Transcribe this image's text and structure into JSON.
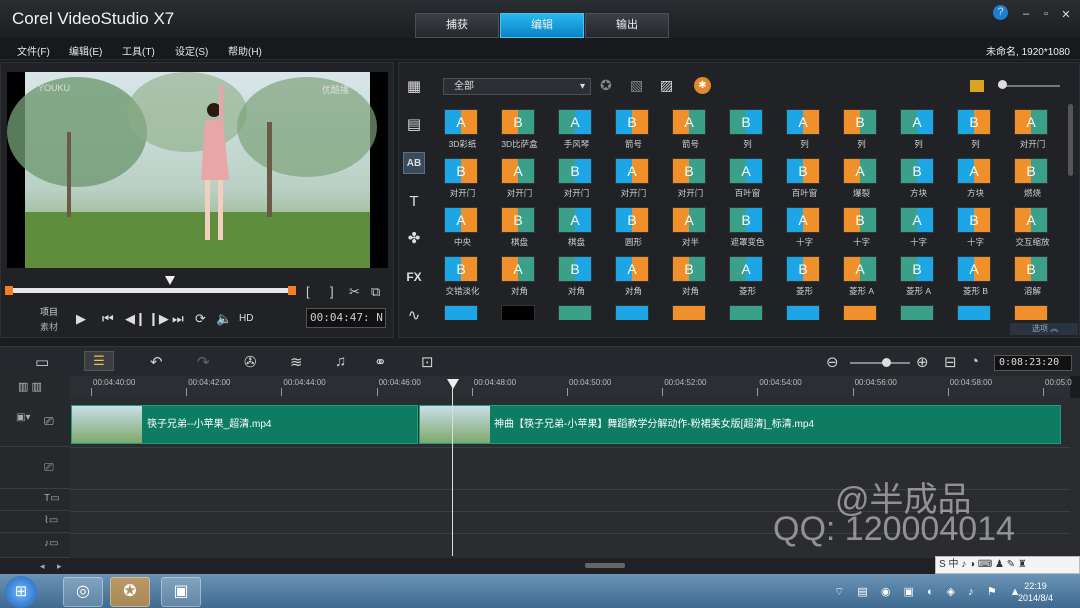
{
  "app_title": "Corel VideoStudio X7",
  "tabs": [
    "捕获",
    "编辑",
    "输出"
  ],
  "window_controls": [
    "?",
    "–",
    "▫",
    "✕"
  ],
  "menu": [
    "文件(F)",
    "编辑(E)",
    "工具(T)",
    "设定(S)",
    "帮助(H)"
  ],
  "doc_info": "未命名, 1920*1080",
  "preview": {
    "watermark_left": "YOUKU",
    "watermark_right": "优酷播",
    "mode_project": "项目",
    "mode_clip": "素材",
    "hd_label": "HD",
    "timecode": "00:04:47: N",
    "playhead_fraction": 0.58
  },
  "library": {
    "dropdown_value": "全部",
    "options_label": "选项",
    "transitions": [
      "3D彩纸",
      "3D比萨盒",
      "手风琴",
      "箭号",
      "箭号",
      "列",
      "列",
      "列",
      "列",
      "列",
      "对开门",
      "对开门",
      "对开门",
      "对开门",
      "对开门",
      "对开门",
      "百叶窗",
      "百叶窗",
      "爆裂",
      "方块",
      "方块",
      "燃烧",
      "中央",
      "棋盘",
      "棋盘",
      "圆形",
      "对半",
      "遮罩变色",
      "十字",
      "十字",
      "十字",
      "十字",
      "交互缩放",
      "交错淡化",
      "对角",
      "对角",
      "对角",
      "对角",
      "菱形",
      "菱形",
      "菱形 A",
      "菱形 A",
      "菱形 B",
      "溶解"
    ]
  },
  "timeline": {
    "current_time": "0:08:23:20",
    "ruler": [
      "00:04:40:00",
      "00:04:42:00",
      "00:04:44:00",
      "00:04:46:00",
      "00:04:48:00",
      "00:04:50:00",
      "00:04:52:00",
      "00:04:54:00",
      "00:04:56:00",
      "00:04:58:00",
      "00:05:0"
    ],
    "clips": [
      {
        "name": "筷子兄弟--小苹果_超清.mp4"
      },
      {
        "name": "神曲【筷子兄弟-小苹果】舞蹈教学分解动作-粉裙美女版[超清]_标清.mp4"
      }
    ]
  },
  "watermark_text": [
    "@半成品",
    "QQ: 120004014"
  ],
  "taskbar": {
    "time": "22:19",
    "date": "2014/8/4",
    "ime": "S 中 ♪ ◑ ⌨ ♟ ✎ ♜"
  },
  "colors": {
    "accent": "#0a9ae0",
    "clip": "#0e7c63",
    "transition_orange": "#f0902a",
    "transition_blue": "#1da6e6",
    "transition_teal": "#3aa08a"
  }
}
